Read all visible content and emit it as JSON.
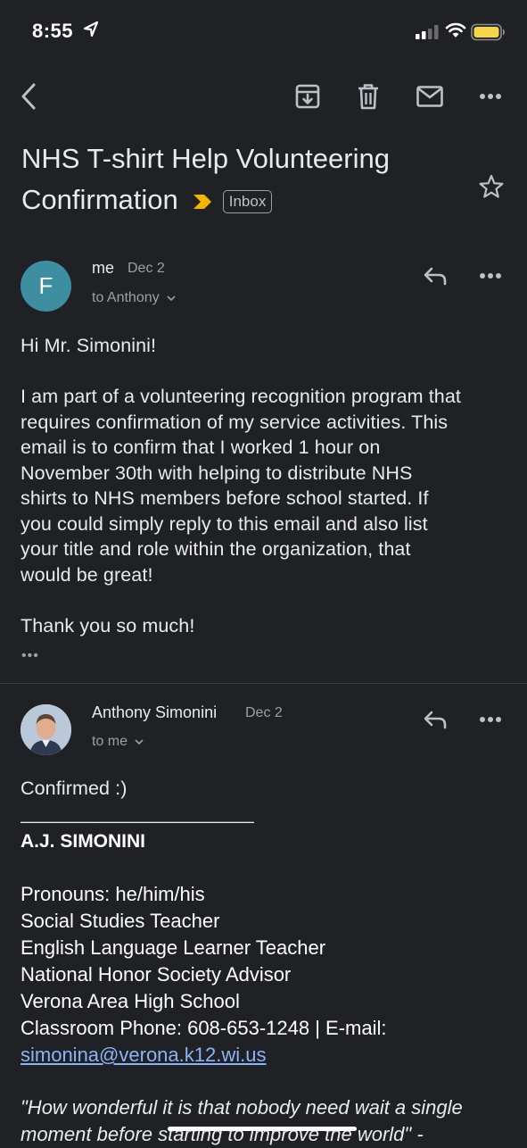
{
  "status_bar": {
    "time": "8:55"
  },
  "toolbar": {
    "back": "back-arrow-icon",
    "archive": "archive-icon",
    "delete": "trash-icon",
    "mark_unread": "mail-icon",
    "more": "more-horizontal-icon"
  },
  "subject": {
    "line1": "NHS T-shirt Help Volunteering",
    "line2": "Confirmation",
    "label": "Inbox"
  },
  "messages": [
    {
      "avatar_letter": "F",
      "sender": "me",
      "date": "Dec 2",
      "to": "to Anthony",
      "body": [
        "Hi Mr. Simonini!",
        "I am part of a volunteering recognition program that",
        "requires confirmation of my service activities. This",
        "email is to confirm that I worked 1 hour on",
        "November 30th with helping to distribute NHS",
        "shirts to NHS members before school started. If",
        "you could simply reply to this email and also list",
        "your title and role within the organization, that",
        "would be great!",
        "Thank you so much!"
      ],
      "collapsed_indicator": "•••"
    },
    {
      "sender": "Anthony Simonini",
      "date": "Dec 2",
      "to": "to me",
      "body": {
        "greeting": "Confirmed :)",
        "rule": "_________________________",
        "name": "A.J. SIMONINI",
        "lines": [
          "Pronouns: he/him/his",
          "Social Studies Teacher",
          "English Language Learner Teacher",
          "National Honor Society Advisor",
          "Verona Area High School",
          "Classroom Phone: 608-653-1248 | E-mail:"
        ],
        "email": "simonina@verona.k12.wi.us",
        "quote_line1": "\"How wonderful it is that nobody need wait a single",
        "quote_line2": "moment before starting to improve the world\" -"
      }
    }
  ],
  "colors": {
    "background": "#202124",
    "text": "#e8eaed",
    "secondary": "#9aa0a6",
    "avatar": "#3d8ea1",
    "important": "#f4b400",
    "link": "#8ab4f8"
  }
}
